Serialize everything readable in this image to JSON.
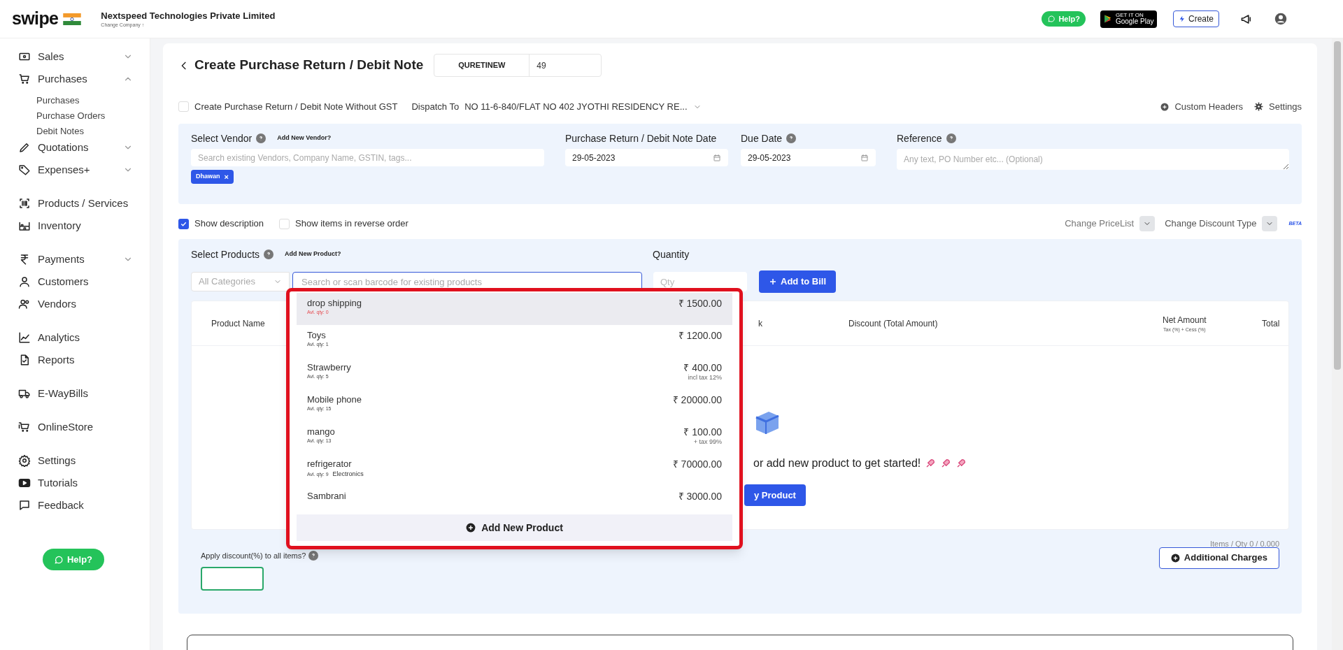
{
  "header": {
    "logo": "swipe",
    "company": "Nextspeed Technologies Private Limited",
    "change_company": "Change Company ↑",
    "help": "Help?",
    "store_small": "GET IT ON",
    "store": "Google Play",
    "create": "Create"
  },
  "sidebar": {
    "groups": [
      [
        {
          "label": "Sales",
          "expanded": false
        },
        {
          "label": "Purchases",
          "expanded": true,
          "children": [
            {
              "label": "Purchases"
            },
            {
              "label": "Purchase Orders"
            },
            {
              "label": "Debit Notes"
            }
          ]
        },
        {
          "label": "Quotations",
          "expanded": false
        },
        {
          "label": "Expenses+",
          "expanded": false
        }
      ],
      [
        {
          "label": "Products / Services"
        },
        {
          "label": "Inventory"
        }
      ],
      [
        {
          "label": "Payments",
          "expanded": false
        },
        {
          "label": "Customers"
        },
        {
          "label": "Vendors"
        }
      ],
      [
        {
          "label": "Analytics"
        },
        {
          "label": "Reports"
        }
      ],
      [
        {
          "label": "E-WayBills"
        }
      ],
      [
        {
          "label": "OnlineStore"
        }
      ],
      [
        {
          "label": "Settings"
        },
        {
          "label": "Tutorials"
        },
        {
          "label": "Feedback"
        }
      ]
    ],
    "help": "Help?"
  },
  "page": {
    "title": "Create Purchase Return / Debit Note",
    "prefix": "QURETINEW",
    "number": "49"
  },
  "options": {
    "without_gst": {
      "label": "Create Purchase Return / Debit Note Without GST",
      "checked": false
    },
    "dispatch_label": "Dispatch To",
    "dispatch_value": "NO 11-6-840/FLAT NO 402 JYOTHI RESIDENCY RE...",
    "custom_headers": "Custom Headers",
    "settings": "Settings"
  },
  "vendor": {
    "label": "Select Vendor",
    "add": "Add New Vendor?",
    "placeholder": "Search existing Vendors, Company Name, GSTIN, tags...",
    "tag": "Dhawan",
    "tag_close": "×",
    "date_label": "Purchase Return / Debit Note Date",
    "date": "29-05-2023",
    "due_label": "Due Date",
    "due": "29-05-2023",
    "reference_label": "Reference",
    "reference_placeholder": "Any text, PO Number etc... (Optional)"
  },
  "toggles": [
    {
      "label": "Show description",
      "checked": true
    },
    {
      "label": "Show items in reverse order",
      "checked": false
    }
  ],
  "pricing": {
    "pricelist": "Change PriceList",
    "discount_type": "Change Discount Type",
    "beta": "BETA"
  },
  "products": {
    "label": "Select Products",
    "add": "Add New Product?",
    "category_placeholder": "All Categories",
    "search_placeholder": "Search or scan barcode for existing products",
    "quantity_label": "Quantity",
    "qty_placeholder": "Qty",
    "add_button": "Add to Bill"
  },
  "table": {
    "columns": [
      {
        "label": "Product Name"
      },
      {
        "label": "k"
      },
      {
        "label": "Discount (Total Amount)"
      },
      {
        "label": "Net Amount",
        "sub": "Tax (%) + Cess (%)"
      },
      {
        "label": "Total"
      }
    ],
    "empty_message": "or add new product to get started!",
    "empty_button": "y Product"
  },
  "dropdown": {
    "items": [
      {
        "name": "drop shipping",
        "qty": "Avl. qty: 0",
        "out_of_stock": true,
        "price": "₹ 1500.00",
        "selected": true
      },
      {
        "name": "Toys",
        "qty": "Avl. qty: 1",
        "out_of_stock": false,
        "price": "₹ 1200.00",
        "selected": false
      },
      {
        "name": "Strawberry",
        "qty": "Avl. qty: 5",
        "out_of_stock": false,
        "price": "₹ 400.00",
        "tax": "incl tax 12%",
        "selected": false
      },
      {
        "name": "Mobile phone",
        "qty": "Avl. qty: 15",
        "out_of_stock": false,
        "price": "₹ 20000.00",
        "selected": false
      },
      {
        "name": "mango",
        "qty": "Avl. qty: 13",
        "out_of_stock": false,
        "price": "₹ 100.00",
        "tax": "+ tax 99%",
        "selected": false
      },
      {
        "name": "refrigerator",
        "qty": "Avl. qty: 9",
        "out_of_stock": false,
        "category": "Electronics",
        "price": "₹ 70000.00",
        "selected": false
      },
      {
        "name": "Sambrani",
        "price": "₹ 3000.00",
        "selected": false
      }
    ],
    "footer": "Add New Product"
  },
  "footer": {
    "items_qty": "Items / Qty 0 / 0.000",
    "discount_label": "Apply discount(%) to all items?",
    "additional_charges": "Additional Charges"
  }
}
